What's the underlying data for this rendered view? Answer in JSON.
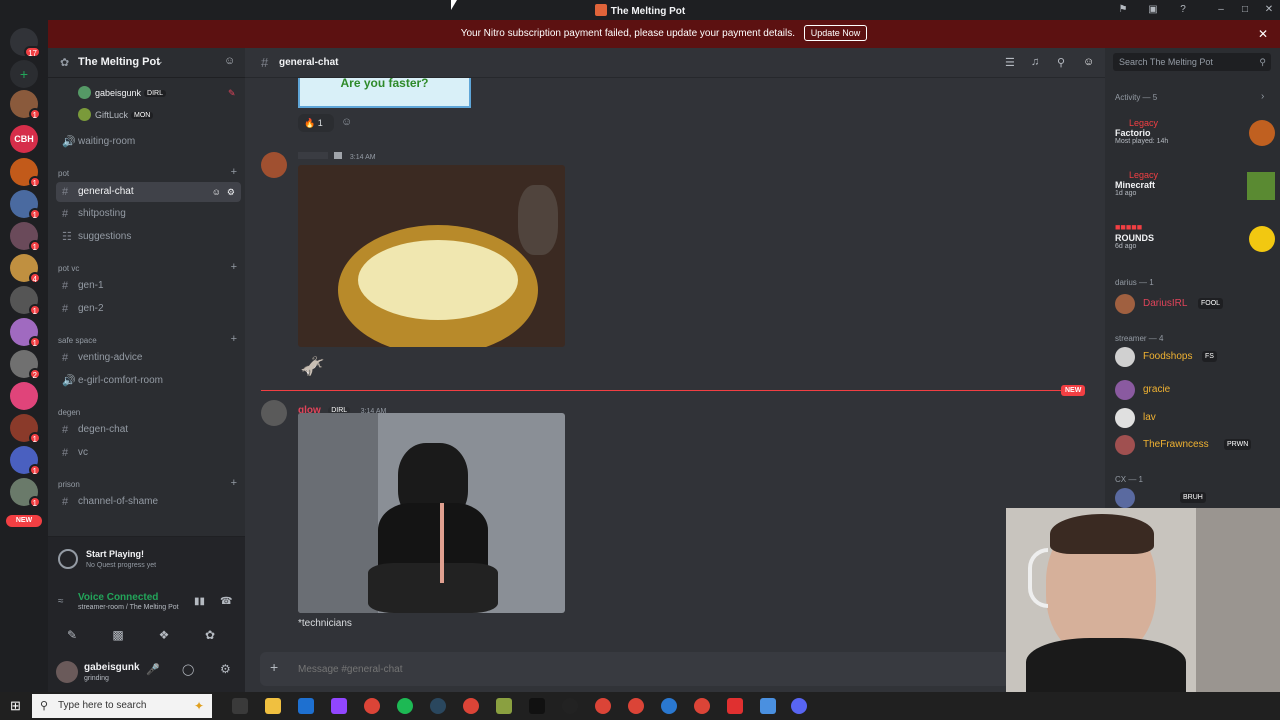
{
  "window": {
    "title": "The Melting Pot"
  },
  "banner": {
    "text": "Your Nitro subscription payment failed, please update your payment details.",
    "button_label": "Update Now"
  },
  "rail": {
    "top_badge": "17",
    "badges": [
      "1",
      "1",
      "1",
      "1",
      "4",
      "1",
      "1",
      "2",
      "1",
      "1",
      "1",
      "1"
    ],
    "cbh_label": "CBH",
    "new_label": "NEW"
  },
  "guild": {
    "name": "The Melting Pot",
    "voice_users": [
      {
        "name": "gabeisgunk",
        "tag": "DIRL"
      },
      {
        "name": "GiftLuck",
        "tag": "MON"
      }
    ],
    "channels": {
      "waiting_room": "waiting-room",
      "cat_pot": "pot",
      "general_chat": "general-chat",
      "shitposting": "shitposting",
      "suggestions": "suggestions",
      "cat_pot_vc": "pot vc",
      "gen1": "gen-1",
      "gen2": "gen-2",
      "cat_safe_space": "safe space",
      "venting_advice": "venting-advice",
      "egirl": "e-girl-comfort-room",
      "cat_degen": "degen",
      "degen_chat": "degen-chat",
      "vc": "vc",
      "cat_prison": "prison",
      "shame": "channel-of-shame"
    }
  },
  "quest": {
    "title": "Start Playing!",
    "subtitle": "No Quest progress yet"
  },
  "voice": {
    "status": "Voice Connected",
    "location": "streamer-room / The Melting Pot"
  },
  "user": {
    "name": "gabeisgunk",
    "status": "grinding"
  },
  "chat": {
    "channel": "general-chat",
    "top_embed_text": "Are you faster?",
    "reaction_count": "1",
    "msg1": {
      "time": "3:14 AM"
    },
    "new_label": "NEW",
    "msg2": {
      "author": "glow",
      "tag": "DIRL",
      "time": "3:14 AM",
      "text": "*technicians"
    },
    "composer_placeholder": "Message #general-chat"
  },
  "members": {
    "search_placeholder": "Search The Melting Pot",
    "activity_header": "Activity — 5",
    "activities": [
      {
        "legacy": "Legacy",
        "game": "Factorio",
        "sub": "Most played: 14h",
        "color": "#c06020"
      },
      {
        "legacy": "Legacy",
        "game": "Minecraft",
        "sub": "1d ago",
        "color": "#5a8a32"
      },
      {
        "legacy": "",
        "game": "ROUNDS",
        "sub": "6d ago",
        "color": "#f2c811"
      }
    ],
    "groups": [
      {
        "label": "darius — 1",
        "members": [
          {
            "name": "DariusIRL",
            "tag": "FOOL",
            "color": "#e0445a"
          }
        ]
      },
      {
        "label": "streamer — 4",
        "members": [
          {
            "name": "Foodshops",
            "tag": "FS",
            "color": "#f0b232"
          },
          {
            "name": "gracie",
            "tag": "",
            "color": "#f0b232"
          },
          {
            "name": "lav",
            "tag": "",
            "color": "#f0b232"
          },
          {
            "name": "TheFrawncess",
            "tag": "PRWN",
            "color": "#f0b232"
          }
        ]
      },
      {
        "label": "CX — 1",
        "members": [
          {
            "name": "",
            "tag": "BRUH",
            "color": "#8c5ad8"
          }
        ]
      }
    ]
  },
  "taskbar": {
    "search_placeholder": "Type here to search"
  }
}
